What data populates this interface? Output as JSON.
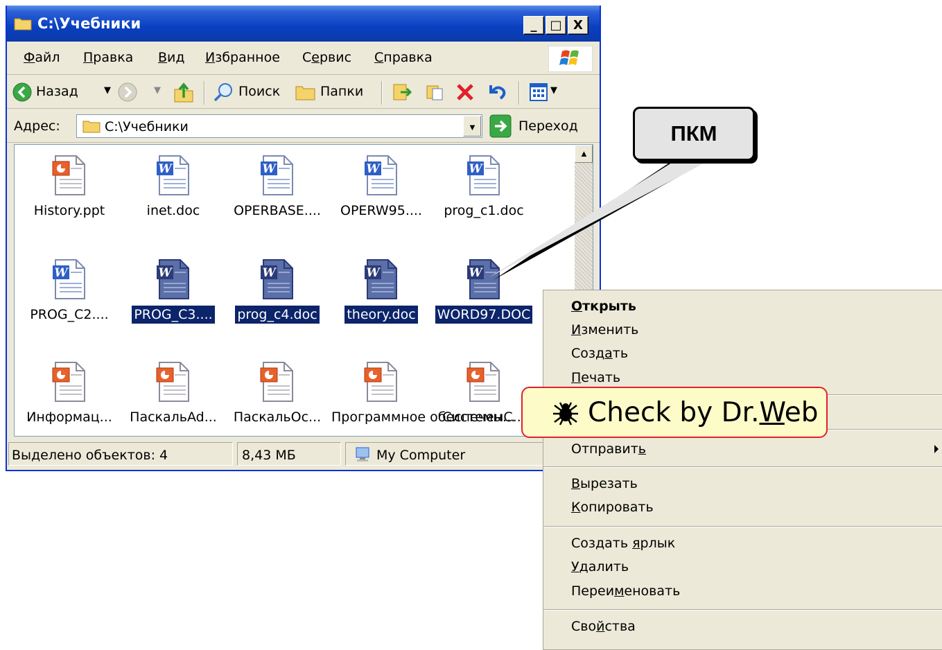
{
  "window": {
    "title": "C:\\Учебники",
    "buttons": {
      "minimize": "_",
      "maximize": "□",
      "close": "X"
    }
  },
  "menubar": [
    {
      "label": "Файл",
      "ul": "Ф",
      "rest": "айл"
    },
    {
      "label": "Правка",
      "ul": "П",
      "rest": "равка"
    },
    {
      "label": "Вид",
      "ul": "В",
      "rest": "ид"
    },
    {
      "label": "Избранное",
      "ul": "И",
      "rest": "збранное"
    },
    {
      "label": "Сервис",
      "pre": "С",
      "ul": "е",
      "rest": "рвис"
    },
    {
      "label": "Справка",
      "ul": "С",
      "rest": "правка"
    }
  ],
  "toolbar": {
    "back_label": "Назад",
    "search_label": "Поиск",
    "folders_label": "Папки"
  },
  "address": {
    "label": "Адрес:",
    "value": "C:\\Учебники",
    "go_label": "Переход"
  },
  "files": [
    {
      "name": "History.ppt",
      "type": "ppt",
      "selected": false
    },
    {
      "name": "inet.doc",
      "type": "doc",
      "selected": false
    },
    {
      "name": "OPERBASE....",
      "type": "doc",
      "selected": false
    },
    {
      "name": "OPERW95....",
      "type": "doc",
      "selected": false
    },
    {
      "name": "prog_c1.doc",
      "type": "doc",
      "selected": false
    },
    {
      "name": "PROG_C2....",
      "type": "doc",
      "selected": false
    },
    {
      "name": "PROG_C3....",
      "type": "doc",
      "selected": true
    },
    {
      "name": "prog_c4.doc",
      "type": "doc",
      "selected": true
    },
    {
      "name": "theory.doc",
      "type": "doc",
      "selected": true
    },
    {
      "name": "WORD97.DOC",
      "type": "doc",
      "selected": true
    },
    {
      "name": "Информац...",
      "type": "ppt",
      "selected": false
    },
    {
      "name": "ПаскальAd...",
      "type": "ppt",
      "selected": false
    },
    {
      "name": "ПаскальОс...",
      "type": "ppt",
      "selected": false
    },
    {
      "name": "Программное обеспечен...",
      "type": "ppt",
      "selected": false
    },
    {
      "name": "СистемыС...",
      "type": "ppt",
      "selected": false
    }
  ],
  "status": {
    "selected": "Выделено объектов: 4",
    "size": "8,43 МБ",
    "location": "My Computer"
  },
  "context_menu": {
    "items": [
      {
        "label": "Открыть",
        "ul": "О",
        "rest": "ткрыть",
        "bold": true
      },
      {
        "label": "Изменить",
        "ul": "И",
        "rest": "зменить"
      },
      {
        "label": "Создать",
        "pre": "Созд",
        "ul": "а",
        "rest": "ть"
      },
      {
        "label": "Печать",
        "ul": "П",
        "rest": "ечать"
      },
      {
        "label": "Отправить",
        "pre": "Отправит",
        "ul": "ь",
        "rest": ""
      },
      {
        "label": "Вырезать",
        "ul": "В",
        "rest": "ырезать"
      },
      {
        "label": "Копировать",
        "ul": "К",
        "rest": "опировать"
      },
      {
        "label": "Создать ярлык",
        "pre": "Создать ",
        "ul": "я",
        "rest": "рлык"
      },
      {
        "label": "Удалить",
        "ul": "У",
        "rest": "далить"
      },
      {
        "label": "Переименовать",
        "pre": "Переи",
        "ul": "м",
        "rest": "еновать"
      },
      {
        "label": "Свойства",
        "pre": "Сво",
        "ul": "й",
        "rest": "ства"
      }
    ],
    "drweb": {
      "pre": "Check by Dr.",
      "ul": "W",
      "rest": "eb"
    }
  },
  "callout": {
    "text": "ПКМ"
  },
  "colors": {
    "selection": "#0b246a",
    "titlebar": "#0a3fc0",
    "highlight_border": "#e0202a",
    "highlight_fill": "#fdfbc8"
  },
  "icons": [
    "folder-icon",
    "windows-logo-icon",
    "back-arrow-icon",
    "forward-arrow-icon",
    "up-folder-icon",
    "search-icon",
    "folders-icon",
    "move-to-icon",
    "copy-to-icon",
    "delete-icon",
    "undo-icon",
    "views-icon",
    "go-arrow-icon",
    "word-doc-icon",
    "powerpoint-icon",
    "computer-icon",
    "drweb-spider-icon"
  ]
}
